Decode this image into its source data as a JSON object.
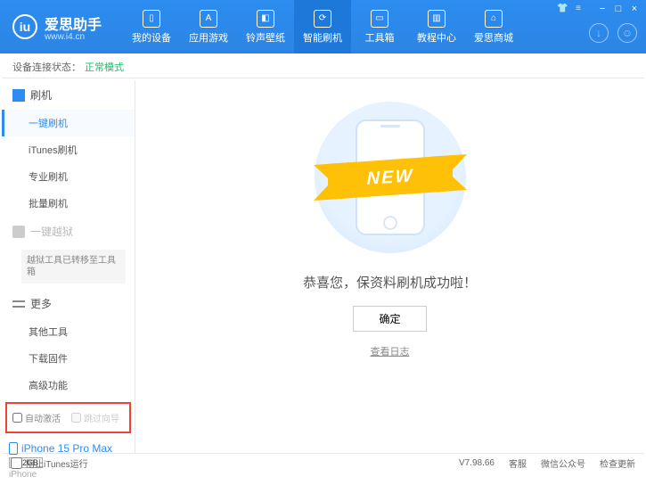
{
  "header": {
    "logo_letter": "iu",
    "app_name": "爱思助手",
    "site_url": "www.i4.cn",
    "nav": [
      {
        "label": "我的设备"
      },
      {
        "label": "应用游戏"
      },
      {
        "label": "铃声壁纸"
      },
      {
        "label": "智能刷机"
      },
      {
        "label": "工具箱"
      },
      {
        "label": "教程中心"
      },
      {
        "label": "爱思商城"
      }
    ],
    "nav_active": 3
  },
  "status": {
    "label": "设备连接状态：",
    "mode": "正常模式"
  },
  "sidebar": {
    "group_flash": "刷机",
    "items_flash": [
      "一键刷机",
      "iTunes刷机",
      "专业刷机",
      "批量刷机"
    ],
    "flash_active": 0,
    "group_jailbreak": "一键越狱",
    "jailbreak_note": "越狱工具已转移至工具箱",
    "group_more": "更多",
    "items_more": [
      "其他工具",
      "下载固件",
      "高级功能"
    ],
    "chk_auto": "自动激活",
    "chk_skip": "跳过向导"
  },
  "device": {
    "name": "iPhone 15 Pro Max",
    "capacity": "512GB",
    "type": "iPhone"
  },
  "main": {
    "ribbon": "NEW",
    "message": "恭喜您，保资料刷机成功啦！",
    "ok": "确定",
    "view_log": "查看日志"
  },
  "footer": {
    "block_itunes": "阻止iTunes运行",
    "version": "V7.98.66",
    "svc": "客服",
    "wechat": "微信公众号",
    "update": "检查更新"
  }
}
